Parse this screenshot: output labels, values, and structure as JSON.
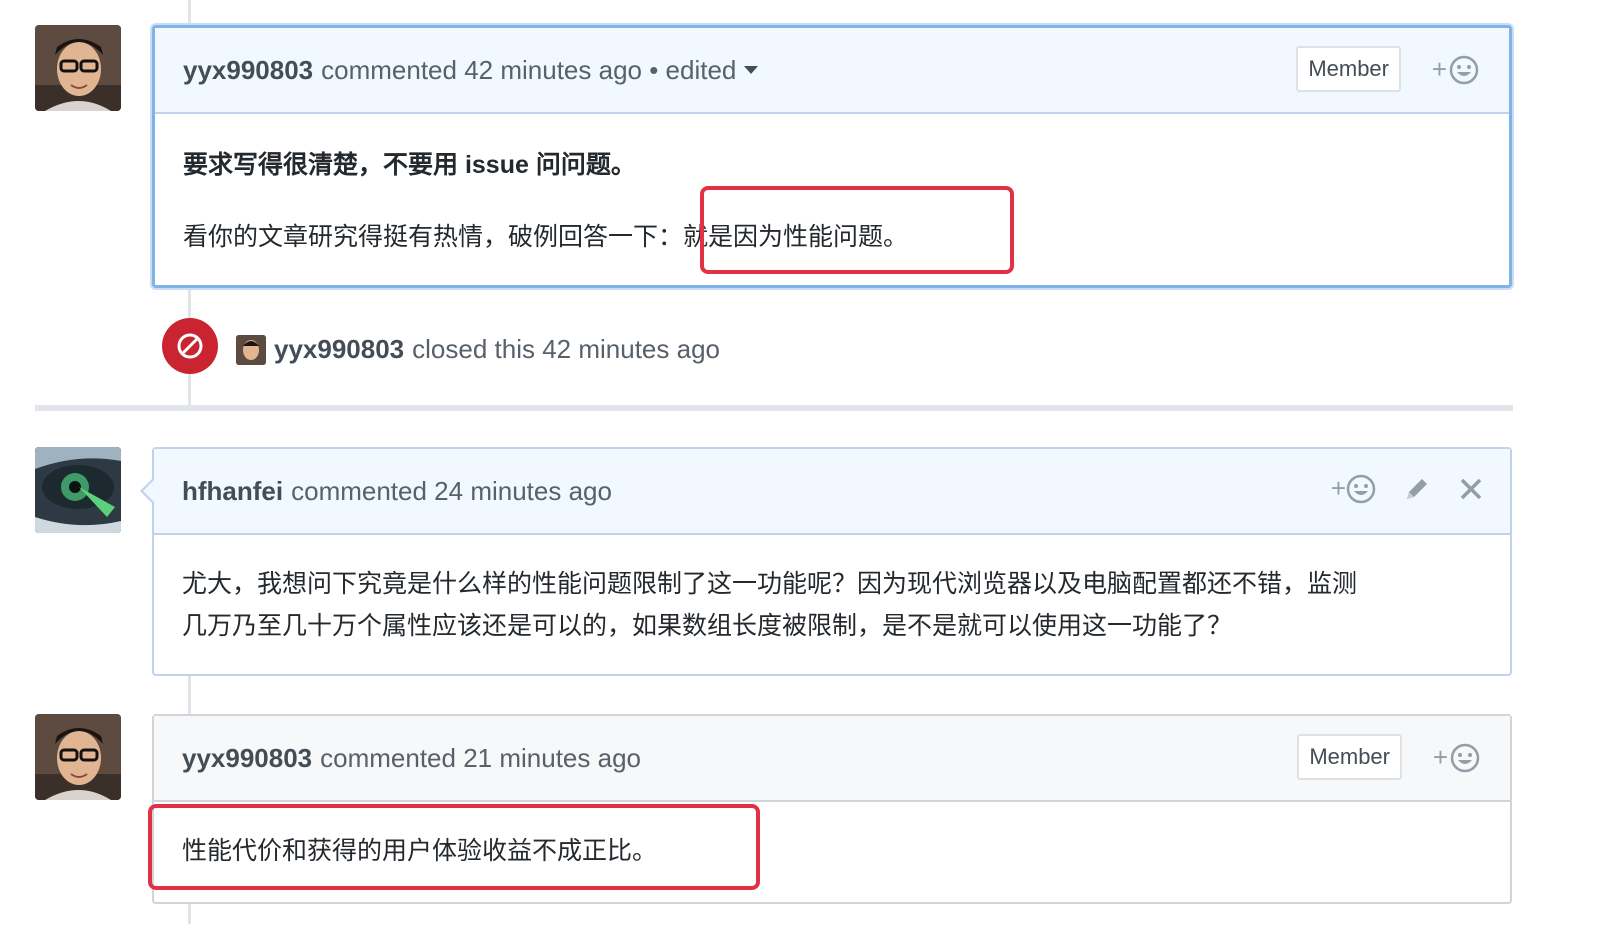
{
  "comments": [
    {
      "author": "yyx990803",
      "meta": "commented 42 minutes ago • edited",
      "badge": "Member",
      "body_line1": "要求写得很清楚，不要用 issue 问问题。",
      "body_line2_prefix": "看你的文章研究得挺有热情，破例回答一下：",
      "body_line2_highlight": "就是因为性能问题。"
    },
    {
      "author": "hfhanfei",
      "meta": "commented 24 minutes ago",
      "body_line1": "尤大，我想问下究竟是什么样的性能问题限制了这一功能呢？因为现代浏览器以及电脑配置都还不错，监测",
      "body_line2": "几万乃至几十万个属性应该还是可以的，如果数组长度被限制，是不是就可以使用这一功能了？"
    },
    {
      "author": "yyx990803",
      "meta": "commented 21 minutes ago",
      "badge": "Member",
      "body_line1": "性能代价和获得的用户体验收益不成正比。"
    }
  ],
  "closed_event": {
    "author": "yyx990803",
    "text": "closed this 42 minutes ago"
  },
  "reaction_plus": "+",
  "colors": {
    "highlight_box": "#e03244",
    "closed_icon": "#cb2431",
    "active_border": "#80b3e8"
  },
  "icons": [
    "smiley-icon",
    "pencil-icon",
    "close-icon",
    "blocked-icon",
    "caret-down-icon"
  ]
}
